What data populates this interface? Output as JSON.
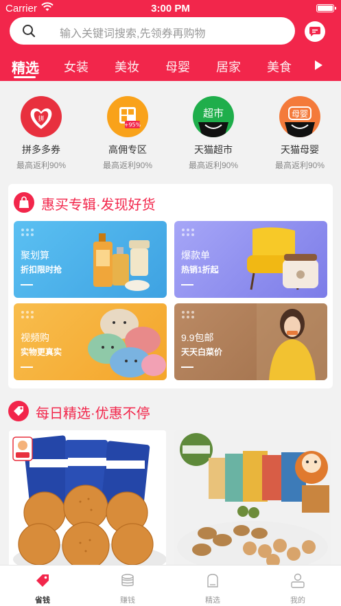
{
  "status_bar": {
    "carrier": "Carrier",
    "time": "3:00 PM"
  },
  "search": {
    "placeholder": "输入关键词搜索,先领券再购物"
  },
  "tabs": [
    {
      "label": "精选",
      "active": true
    },
    {
      "label": "女装"
    },
    {
      "label": "美妆"
    },
    {
      "label": "母婴"
    },
    {
      "label": "居家"
    },
    {
      "label": "美食"
    }
  ],
  "quick_links": [
    {
      "title": "拼多多券",
      "subtitle": "最高返利90%",
      "icon": "pinduoduo-icon",
      "color": "#e8303e"
    },
    {
      "title": "高佣专区",
      "subtitle": "最高返利90%",
      "icon": "high-commission-icon",
      "color": "#f9a21a",
      "badge": "+95%"
    },
    {
      "title": "天猫超市",
      "subtitle": "最高返利90%",
      "icon": "tmall-supermarket-icon",
      "color": "#1fae4b",
      "badge": "超市"
    },
    {
      "title": "天猫母婴",
      "subtitle": "最高返利90%",
      "icon": "tmall-baby-icon",
      "color": "#f47a3a",
      "badge": "母婴"
    }
  ],
  "section1": {
    "title": "惠买专辑·发现好货",
    "promos": [
      {
        "title": "聚划算",
        "subtitle": "折扣限时抢",
        "color": "#4fb4ec"
      },
      {
        "title": "爆款单",
        "subtitle": "热销1折起",
        "color": "#8e8ef0"
      },
      {
        "title": "视频购",
        "subtitle": "实物更真实",
        "color": "#f7b03a"
      },
      {
        "title": "9.9包邮",
        "subtitle": "天天白菜价",
        "color": "#b07c55"
      }
    ]
  },
  "section2": {
    "title": "每日精选·优惠不停"
  },
  "tabbar": [
    {
      "label": "省钱",
      "icon": "tag-icon",
      "active": true
    },
    {
      "label": "赚钱",
      "icon": "coins-icon"
    },
    {
      "label": "精选",
      "icon": "bag-icon"
    },
    {
      "label": "我的",
      "icon": "user-icon"
    }
  ],
  "colors": {
    "brand": "#f2264b",
    "background": "#f2f2f2"
  }
}
